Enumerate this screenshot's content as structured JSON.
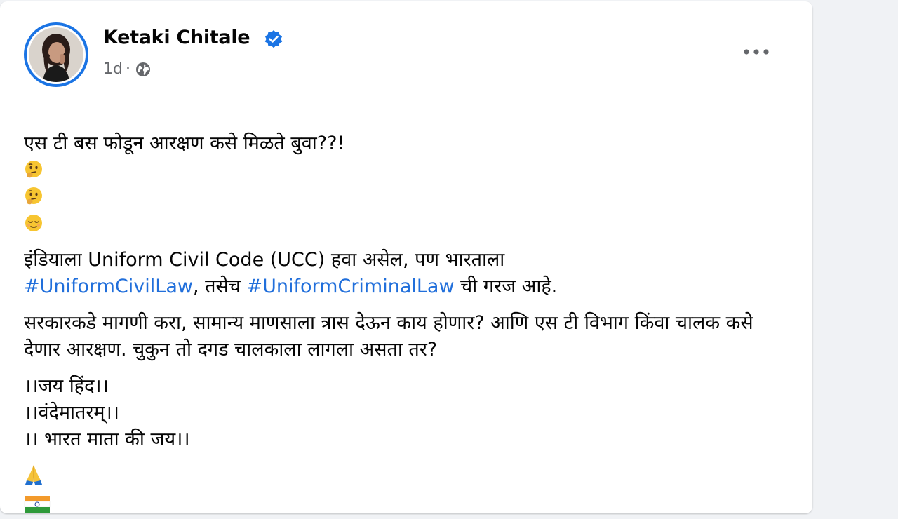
{
  "post": {
    "author_name": "Ketaki Chitale",
    "timestamp": "1d",
    "separator": "·",
    "more_icon": "more-horizontal-icon",
    "line1_text": "एस टी बस फोडून आरक्षण कसे मिळते बुवा??!",
    "line1_emojis": [
      "thinking-face-icon",
      "thinking-face-icon",
      "relieved-face-icon"
    ],
    "para2_part1": "इंडियाला Uniform Civil Code (UCC) हवा असेल, पण भारताला",
    "hashtag1": "#UniformCivilLaw",
    "para2_part2": ", तसेच ",
    "hashtag2": "#UniformCriminalLaw",
    "para2_part3": " ची गरज आहे.",
    "para3": "सरकारकडे मागणी करा, सामान्य माणसाला त्रास देऊन काय होणार? आणि एस टी विभाग किंवा चालक कसे देणार आरक्षण. चुकुन तो दगड चालकाला लागला असता तर?",
    "closing_line1": "।।जय हिंद।।",
    "closing_line2": "।।वंदेमातरम्।।",
    "closing_line3": "।। भारत माता की जय।।",
    "end_icons": [
      "folded-hands-icon",
      "india-flag-icon"
    ]
  },
  "colors": {
    "accent": "#1b74e4",
    "hashtag": "#216fdb",
    "text_primary": "#050505",
    "text_secondary": "#65676b",
    "background": "#f0f2f5",
    "card": "#ffffff"
  }
}
